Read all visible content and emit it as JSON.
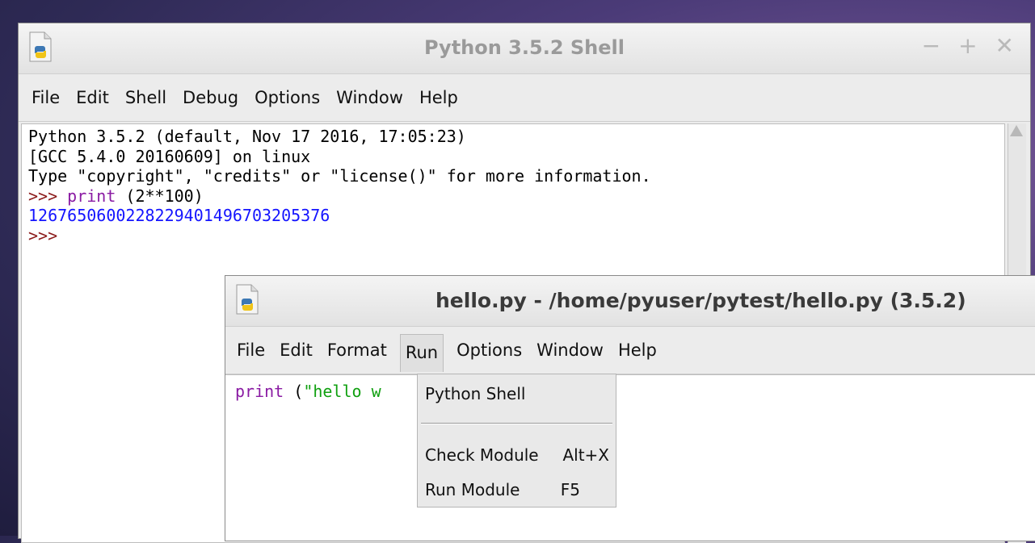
{
  "shell": {
    "title": "Python 3.5.2 Shell",
    "controls": {
      "minimize": "−",
      "maximize": "+",
      "close": "✕"
    },
    "menu": [
      "File",
      "Edit",
      "Shell",
      "Debug",
      "Options",
      "Window",
      "Help"
    ],
    "lines": {
      "l1": "Python 3.5.2 (default, Nov 17 2016, 17:05:23)",
      "l2": "[GCC 5.4.0 20160609] on linux",
      "l3": "Type \"copyright\", \"credits\" or \"license()\" for more information.",
      "prompt": ">>> ",
      "cmd_kw": "print",
      "cmd_rest": " (2**100)",
      "result": "1267650600228229401496703205376",
      "prompt2": ">>>"
    }
  },
  "editor": {
    "title": "hello.py - /home/pyuser/pytest/hello.py (3.5.2)",
    "menu": [
      "File",
      "Edit",
      "Format",
      "Run",
      "Options",
      "Window",
      "Help"
    ],
    "code_kw": "print",
    "code_paren": " (",
    "code_str": "\"hello w"
  },
  "run_menu": {
    "python_shell": "Python Shell",
    "check_module": "Check Module",
    "check_shortcut": "Alt+X",
    "run_module": "Run Module",
    "run_shortcut": "F5"
  },
  "colors": {
    "prompt": "#8b1a1a",
    "keyword": "#8a1ba3",
    "output": "#1414ff",
    "string": "#10a010"
  }
}
